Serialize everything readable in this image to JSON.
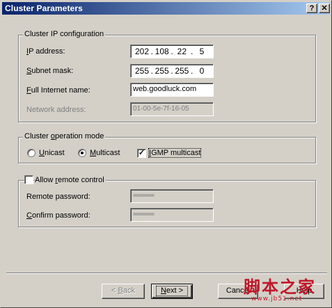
{
  "window": {
    "title": "Cluster Parameters",
    "help_glyph": "?",
    "close_glyph": "✕"
  },
  "ip_config": {
    "legend": "Cluster IP configuration",
    "ip_label_u": "I",
    "ip_label_rest": "P address:",
    "ip_octets": [
      "202",
      "108",
      "22",
      "5"
    ],
    "subnet_label_u": "S",
    "subnet_label_rest": "ubnet mask:",
    "subnet_octets": [
      "255",
      "255",
      "255",
      "0"
    ],
    "fullname_label_u": "F",
    "fullname_label_rest": "ull Internet name:",
    "fullname_value": "web.goodluck.com",
    "netaddr_label": "Network address:",
    "netaddr_value": "01-00-5e-7f-16-05",
    "dot": "."
  },
  "op_mode": {
    "legend_pre": "Cluster ",
    "legend_u": "o",
    "legend_post": "peration mode",
    "unicast_u": "U",
    "unicast_rest": "nicast",
    "multicast_u": "M",
    "multicast_rest": "ulticast",
    "igmp_u": "I",
    "igmp_rest": "GMP multicast",
    "selected": "multicast",
    "igmp_checked": true
  },
  "remote": {
    "legend_pre": "Allow ",
    "legend_u": "r",
    "legend_post": "emote control",
    "checked": false,
    "remote_pw_label": "Remote password:",
    "remote_pw_mask": "xxxxxxxxxxxx",
    "confirm_pw_label_u": "C",
    "confirm_pw_label_rest": "onfirm password:",
    "confirm_pw_mask": "xxxxxxxxxxxx"
  },
  "buttons": {
    "back_pre": "< ",
    "back_u": "B",
    "back_post": "ack",
    "next_u": "N",
    "next_post": "ext >",
    "cancel": "Cancel",
    "help": "Help"
  },
  "watermark": {
    "text": "脚本之家",
    "sub": "www.jb51.net"
  }
}
